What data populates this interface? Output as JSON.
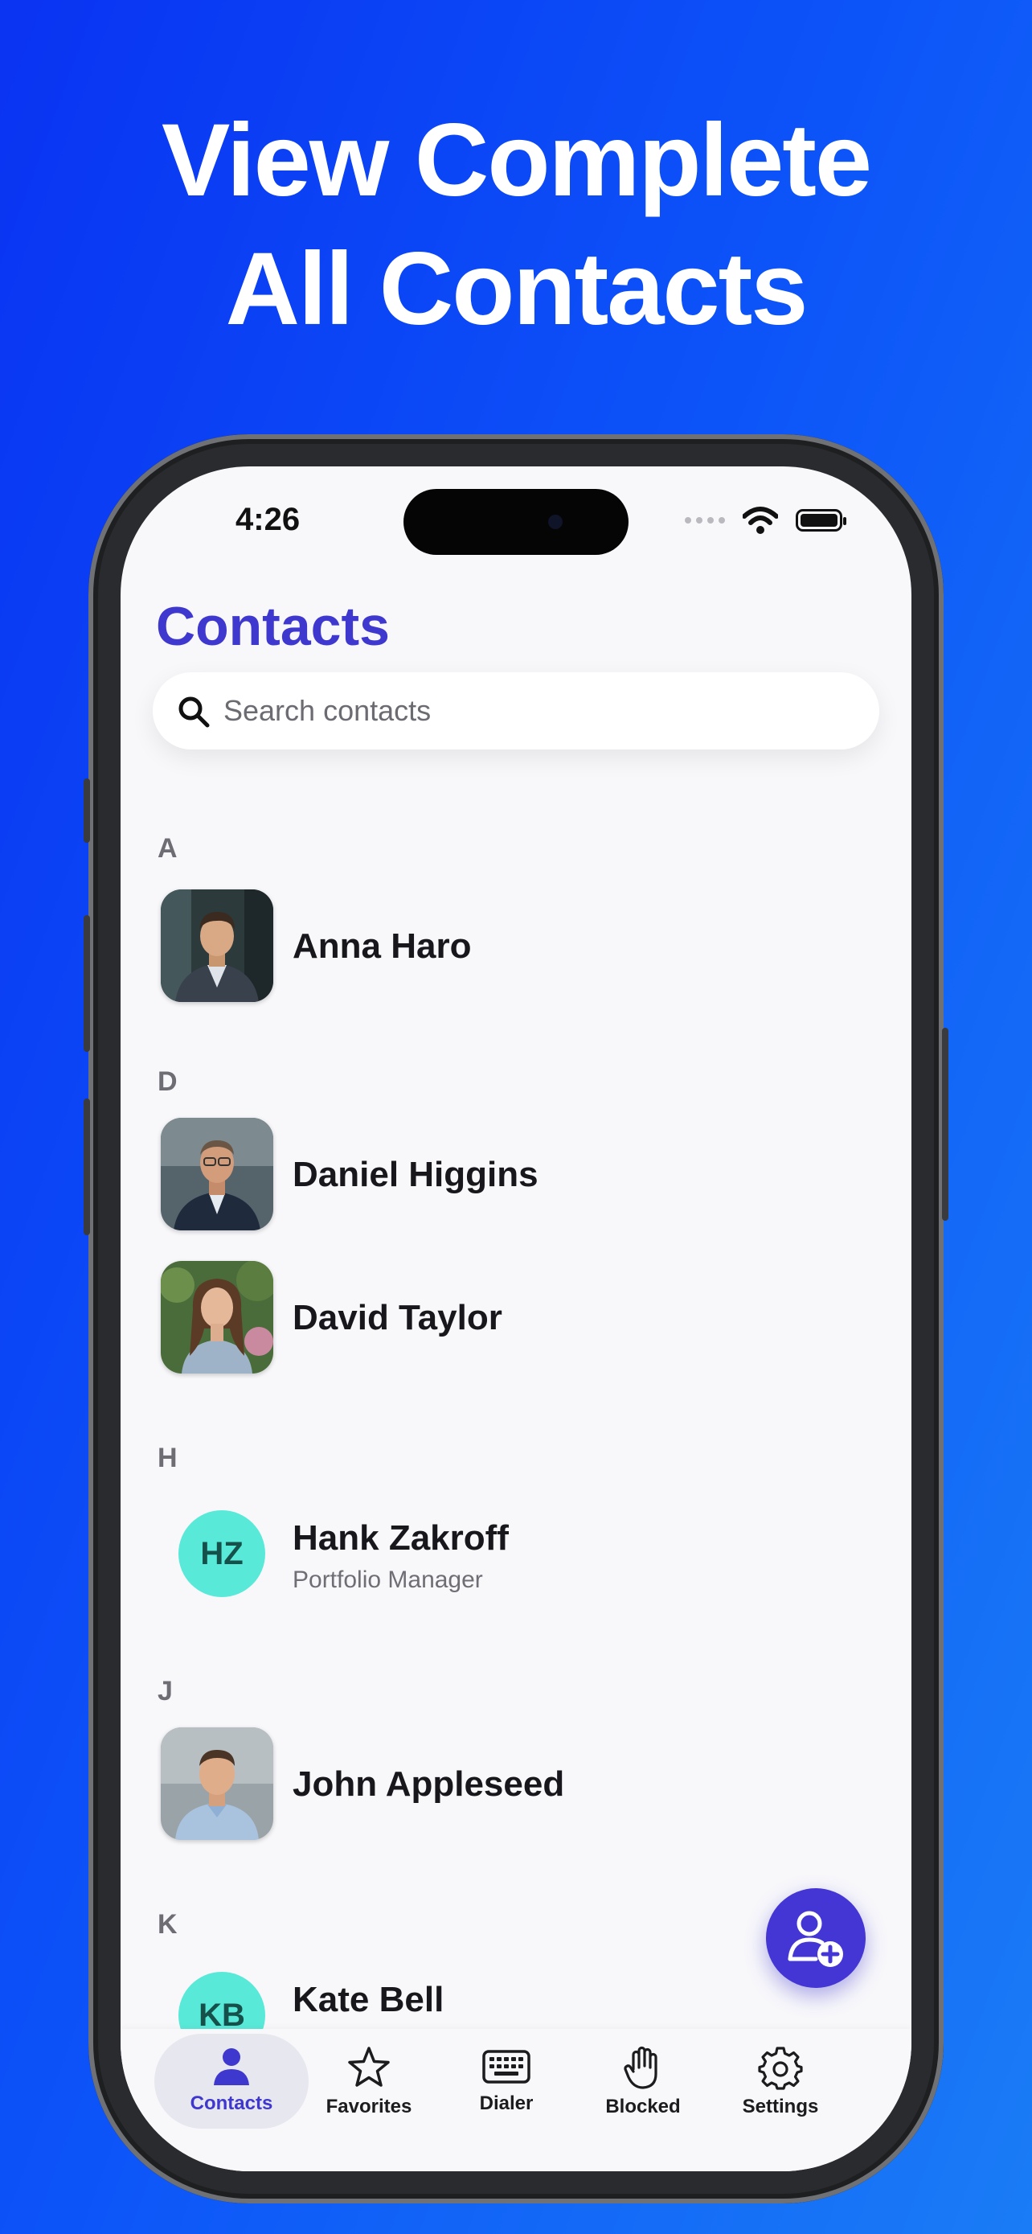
{
  "headline": {
    "line1": "View Complete",
    "line2": "All Contacts"
  },
  "status_bar": {
    "time": "4:26"
  },
  "page": {
    "title": "Contacts"
  },
  "search": {
    "placeholder": "Search contacts"
  },
  "sections": [
    {
      "letter": "A",
      "contacts": [
        {
          "name": "Anna Haro",
          "avatar": "photo"
        }
      ]
    },
    {
      "letter": "D",
      "contacts": [
        {
          "name": "Daniel Higgins",
          "avatar": "photo"
        },
        {
          "name": "David Taylor",
          "avatar": "photo"
        }
      ]
    },
    {
      "letter": "H",
      "contacts": [
        {
          "name": "Hank Zakroff",
          "subtitle": "Portfolio Manager",
          "initials": "HZ"
        }
      ]
    },
    {
      "letter": "J",
      "contacts": [
        {
          "name": "John Appleseed",
          "avatar": "photo"
        }
      ]
    },
    {
      "letter": "K",
      "contacts": [
        {
          "name": "Kate Bell",
          "initials": "KB"
        }
      ]
    }
  ],
  "tabs": [
    {
      "label": "Contacts",
      "icon": "person-icon",
      "active": true
    },
    {
      "label": "Favorites",
      "icon": "star-icon"
    },
    {
      "label": "Dialer",
      "icon": "keyboard-icon"
    },
    {
      "label": "Blocked",
      "icon": "hand-icon"
    },
    {
      "label": "Settings",
      "icon": "gear-icon"
    }
  ],
  "fab": {
    "icon": "add-contact-icon"
  },
  "colors": {
    "accent": "#3f38cf",
    "fab": "#4436d4",
    "initials_bg": "#59e9d9",
    "background_start": "#0a33f2",
    "background_end": "#1a7cf6"
  }
}
